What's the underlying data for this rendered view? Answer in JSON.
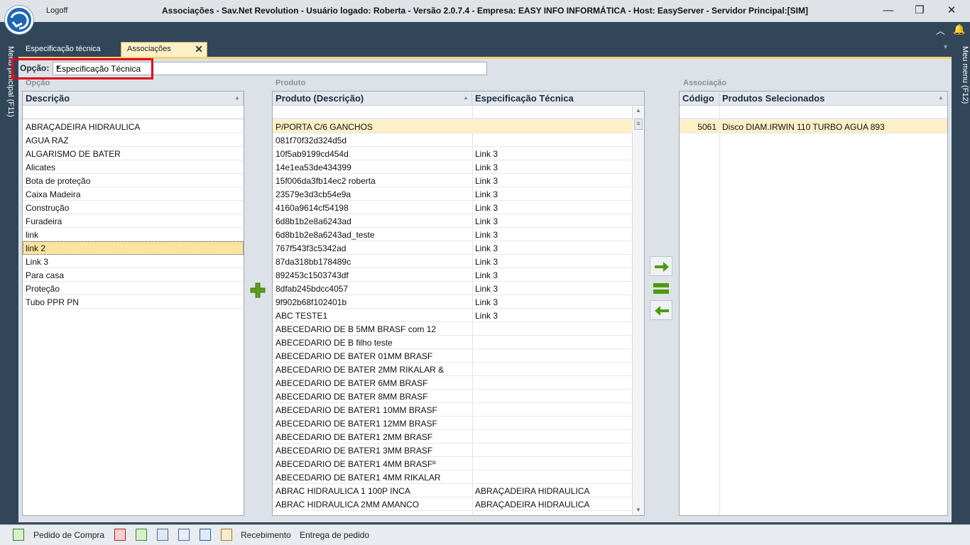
{
  "window": {
    "logoff_label": "Logoff",
    "title": "Associações - Sav.Net Revolution - Usuário logado: Roberta - Versão 2.0.7.4 - Empresa: EASY INFO INFORMÁTICA - Host: EasyServer - Servidor Principal:[SIM]",
    "minimize": "—",
    "restore": "❐",
    "close": "✕"
  },
  "side": {
    "left_label": "Menu principal (F11)",
    "right_label": "Meu menu (F12)"
  },
  "tabs": [
    {
      "label": "Especificação técnica",
      "active": false
    },
    {
      "label": "Associações",
      "active": true,
      "close": "✕"
    }
  ],
  "option": {
    "label": "Opção:",
    "value": "Especificação Técnica",
    "dropdown_icon": "▾"
  },
  "groups": {
    "opcao": "Opção",
    "produto": "Produto",
    "associacao": "Associação"
  },
  "opcao_grid": {
    "header": "Descrição",
    "rows": [
      "ABRAÇADEIRA HIDRAULICA",
      "AGUA RAZ",
      "ALGARISMO DE BATER",
      "Alicates",
      "Bota de proteção",
      "Caixa Madeira",
      "Construção",
      "Furadeira",
      "link",
      "link 2",
      "Link 3",
      "Para casa",
      "Proteção",
      "Tubo PPR PN"
    ],
    "selected_index": 9
  },
  "produto_grid": {
    "headers": [
      "Produto (Descrição)",
      "Especificação Técnica"
    ],
    "rows": [
      [
        "P/PORTA C/6 GANCHOS",
        ""
      ],
      [
        "081f70f32d324d5d",
        ""
      ],
      [
        "10f5ab9199cd454d",
        "Link 3"
      ],
      [
        "14e1ea53de434399",
        "Link 3"
      ],
      [
        "15f006da3fb14ec2 roberta",
        "Link 3"
      ],
      [
        "23579e3d3cb54e9a",
        "Link 3"
      ],
      [
        "4160a9614cf54198",
        "Link 3"
      ],
      [
        "6d8b1b2e8a6243ad",
        "Link 3"
      ],
      [
        "6d8b1b2e8a6243ad_teste",
        "Link 3"
      ],
      [
        "767f543f3c5342ad",
        "Link 3"
      ],
      [
        "87da318bb178489c",
        "Link 3"
      ],
      [
        "892453c1503743df",
        "Link 3"
      ],
      [
        "8dfab245bdcc4057",
        "Link 3"
      ],
      [
        "9f902b68f102401b",
        "Link 3"
      ],
      [
        "ABC TESTE1",
        "Link 3"
      ],
      [
        "ABECEDARIO DE B 5MM BRASF com 12",
        ""
      ],
      [
        "ABECEDARIO DE B filho teste",
        ""
      ],
      [
        "ABECEDARIO DE BATER 01MM BRASF",
        ""
      ],
      [
        "ABECEDARIO DE BATER 2MM RIKALAR &",
        ""
      ],
      [
        "ABECEDARIO DE BATER 6MM BRASF",
        ""
      ],
      [
        "ABECEDARIO DE BATER 8MM BRASF",
        ""
      ],
      [
        "ABECEDARIO DE BATER1 10MM BRASF",
        ""
      ],
      [
        "ABECEDARIO DE BATER1 12MM BRASF",
        ""
      ],
      [
        "ABECEDARIO DE BATER1 2MM BRASF",
        ""
      ],
      [
        "ABECEDARIO DE BATER1 3MM BRASF",
        ""
      ],
      [
        "ABECEDARIO DE BATER1 4MM BRASFº",
        ""
      ],
      [
        "ABECEDARIO DE BATER1 4MM RIKALAR",
        ""
      ],
      [
        "ABRAC HIDRAULICA 1 100P INCA",
        "ABRAÇADEIRA HIDRAULICA"
      ],
      [
        "ABRAC HIDRAULICA 2MM AMANCO",
        "ABRAÇADEIRA HIDRAULICA"
      ]
    ]
  },
  "associacao_grid": {
    "headers": [
      "Código",
      "Produtos Selecionados"
    ],
    "rows": [
      [
        "5061",
        "Disco DIAM.IRWIN 110 TURBO AGUA 893"
      ]
    ]
  },
  "statusbar": {
    "items": [
      "Pedido de Compra",
      "Recebimento",
      "Entrega de pedido"
    ]
  },
  "colors": {
    "accent": "#f2d27a",
    "selected_row": "#fdf0c7",
    "arrow_green": "#4e9a06",
    "highlight_red": "#e0001b"
  }
}
